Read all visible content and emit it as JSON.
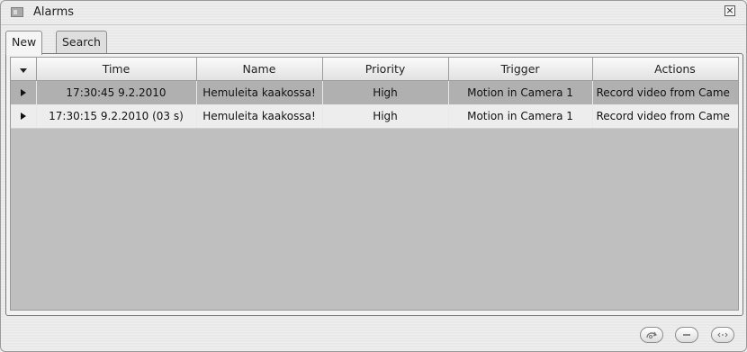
{
  "window": {
    "title": "Alarms"
  },
  "tabs": [
    {
      "label": "New",
      "active": true
    },
    {
      "label": "Search",
      "active": false
    }
  ],
  "table": {
    "columns": [
      "Time",
      "Name",
      "Priority",
      "Trigger",
      "Actions"
    ],
    "rows": [
      {
        "time": "17:30:45 9.2.2010",
        "name": "Hemuleita kaakossa!",
        "priority": "High",
        "trigger": "Motion in Camera 1",
        "actions": "Record video from Came",
        "selected": true
      },
      {
        "time": "17:30:15 9.2.2010 (03 s)",
        "name": "Hemuleita kaakossa!",
        "priority": "High",
        "trigger": "Motion in Camera 1",
        "actions": "Record video from Came",
        "selected": false
      }
    ]
  },
  "icons": {
    "close": "close-icon",
    "sort": "sort-down-icon",
    "expand": "expand-row-icon",
    "acknowledge": "acknowledge-icon",
    "remove": "remove-icon",
    "details": "details-icon"
  }
}
